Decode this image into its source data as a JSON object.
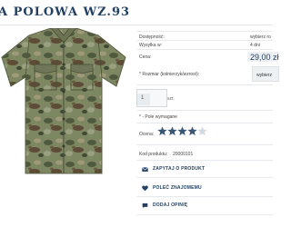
{
  "product": {
    "title": "A POLOWA WZ.93",
    "image_alt": "camouflage field shirt"
  },
  "info": {
    "availability_label": "Dostępność:",
    "availability_value": "wybierz ro",
    "shipping_label": "Wysyłka w:",
    "shipping_value": "4 dni",
    "price_label": "Cena:",
    "price_value": "29,00 zł"
  },
  "options": {
    "size_label": "* Rozmiar (kołnierzyk/wzrost):",
    "size_value": "wybierz"
  },
  "quantity": {
    "value": "1",
    "unit": "szt."
  },
  "required_note": "* - Pole wymagane",
  "rating": {
    "label": "Ocena:",
    "value": 4,
    "max": 5
  },
  "code": {
    "label": "Kod produktu:",
    "value": "20000101"
  },
  "actions": {
    "ask": "ZAPYTAJ O PRODUKT",
    "recommend": "POLEĆ ZNAJOMEMU",
    "review": "DODAJ OPINIĘ"
  },
  "colors": {
    "accent": "#234063",
    "star": "#3b5878"
  }
}
